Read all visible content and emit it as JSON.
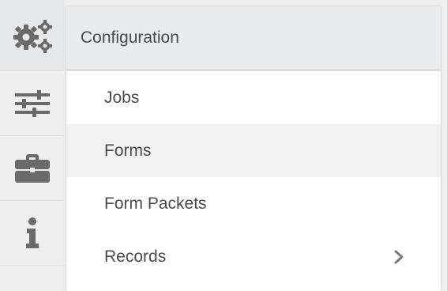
{
  "rail": {
    "items": [
      {
        "icon": "gears-icon",
        "active": true
      },
      {
        "icon": "sliders-icon",
        "active": false
      },
      {
        "icon": "briefcase-icon",
        "active": false
      },
      {
        "icon": "info-icon",
        "active": false
      }
    ]
  },
  "flyout": {
    "title": "Configuration",
    "items": [
      {
        "label": "Jobs"
      },
      {
        "label": "Forms"
      },
      {
        "label": "Form Packets"
      },
      {
        "label": "Records",
        "has_submenu": true
      }
    ]
  },
  "colors": {
    "icon": "#6a6a6a",
    "text": "#4a4a4a",
    "rail_bg": "#efefef",
    "header_bg": "#eaebed",
    "hover_bg": "#f1f1f1"
  }
}
